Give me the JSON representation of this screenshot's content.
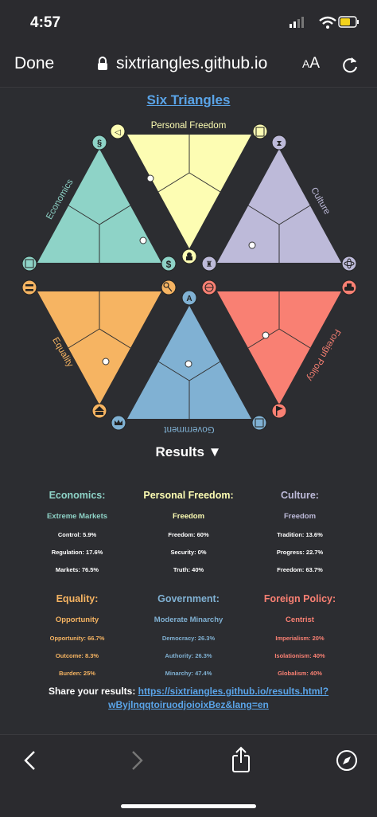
{
  "status": {
    "time": "4:57"
  },
  "browser": {
    "done_label": "Done",
    "url": "sixtriangles.github.io",
    "text_size_label_small": "A",
    "text_size_label_large": "A"
  },
  "page": {
    "title": "Six Triangles",
    "triangles": {
      "personal_freedom": "Personal Freedom",
      "economics": "Economics",
      "culture": "Culture",
      "equality": "Equality",
      "foreign_policy": "Foreign Policy",
      "government": "Government"
    },
    "results_toggle": "Results ▼",
    "results": [
      {
        "heading": "Economics:",
        "label": "Extreme Markets",
        "color": "#8ed3c7",
        "items": [
          "Control: 5.9%",
          "Regulation: 17.6%",
          "Markets: 76.5%"
        ]
      },
      {
        "heading": "Personal Freedom:",
        "label": "Freedom",
        "color": "#fdfdb3",
        "items": [
          "Freedom: 60%",
          "Security: 0%",
          "Truth: 40%"
        ]
      },
      {
        "heading": "Culture:",
        "label": "Freedom",
        "color": "#bdbad9",
        "items": [
          "Tradition: 13.6%",
          "Progress: 22.7%",
          "Freedom: 63.7%"
        ]
      },
      {
        "heading": "Equality:",
        "label": "Opportunity",
        "color": "#f6b462",
        "items": [
          "Opportunity: 66.7%",
          "Outcome: 8.3%",
          "Burden: 25%"
        ]
      },
      {
        "heading": "Government:",
        "label": "Moderate Minarchy",
        "color": "#80b1d3",
        "items": [
          "Democracy: 26.3%",
          "Authority: 26.3%",
          "Minarchy: 47.4%"
        ]
      },
      {
        "heading": "Foreign Policy:",
        "label": "Centrist",
        "color": "#f98073",
        "items": [
          "Imperialism: 20%",
          "Isolationism: 40%",
          "Globalism: 40%"
        ]
      }
    ],
    "share_prefix": "Share your results: ",
    "share_link_line1": "https://sixtriangles.github.io/results.html?",
    "share_link_line2": "wByjlnqqtoiruodjoioixBez&lang=en"
  },
  "colors": {
    "economics": "#8ed3c7",
    "personal_freedom": "#fdfdb3",
    "culture": "#bdbad9",
    "equality": "#f6b462",
    "government": "#80b1d3",
    "foreign_policy": "#f98073",
    "link": "#5aa4e8"
  }
}
